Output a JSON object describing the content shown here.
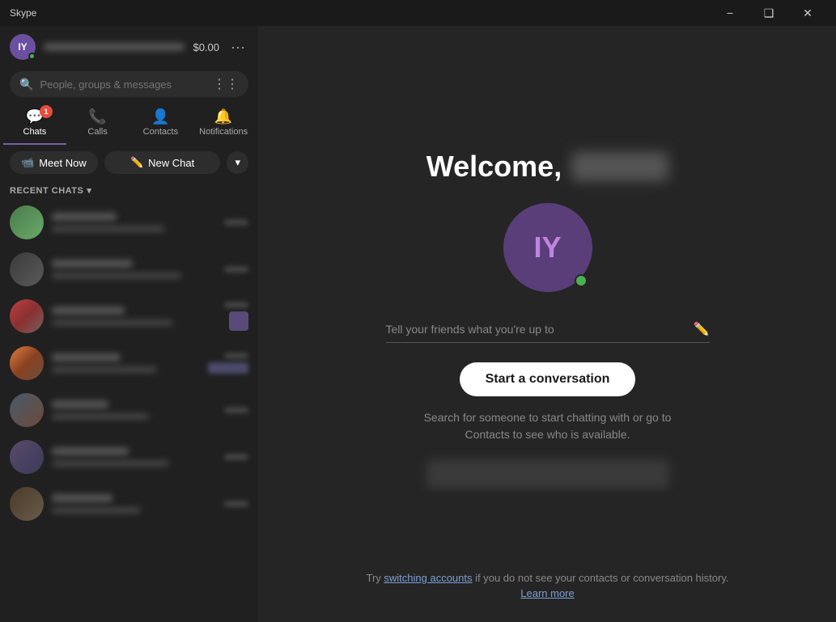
{
  "app": {
    "title": "Skype"
  },
  "titlebar": {
    "minimize_label": "−",
    "maximize_label": "❑",
    "close_label": "✕"
  },
  "profile": {
    "initials": "IY",
    "credit": "$0.00"
  },
  "search": {
    "placeholder": "People, groups & messages"
  },
  "nav": {
    "tabs": [
      {
        "id": "chats",
        "label": "Chats",
        "badge": "1",
        "active": true
      },
      {
        "id": "calls",
        "label": "Calls",
        "badge": null
      },
      {
        "id": "contacts",
        "label": "Contacts",
        "badge": null
      },
      {
        "id": "notifications",
        "label": "Notifications",
        "badge": null
      }
    ]
  },
  "actions": {
    "meet_now": "Meet Now",
    "new_chat": "New Chat"
  },
  "recent_chats": {
    "label": "RECENT CHATS"
  },
  "main": {
    "welcome_prefix": "Welcome,",
    "avatar_initials": "IY",
    "status_placeholder": "Tell your friends what you're up to",
    "start_conversation": "Start a conversation",
    "conv_description_line1": "Search for someone to start chatting with or go to",
    "conv_description_line2": "Contacts to see who is available.",
    "footer_text_pre": "Try ",
    "footer_link": "switching accounts",
    "footer_text_post": " if you do not see your contacts or conversation history.",
    "learn_more": "Learn more"
  }
}
